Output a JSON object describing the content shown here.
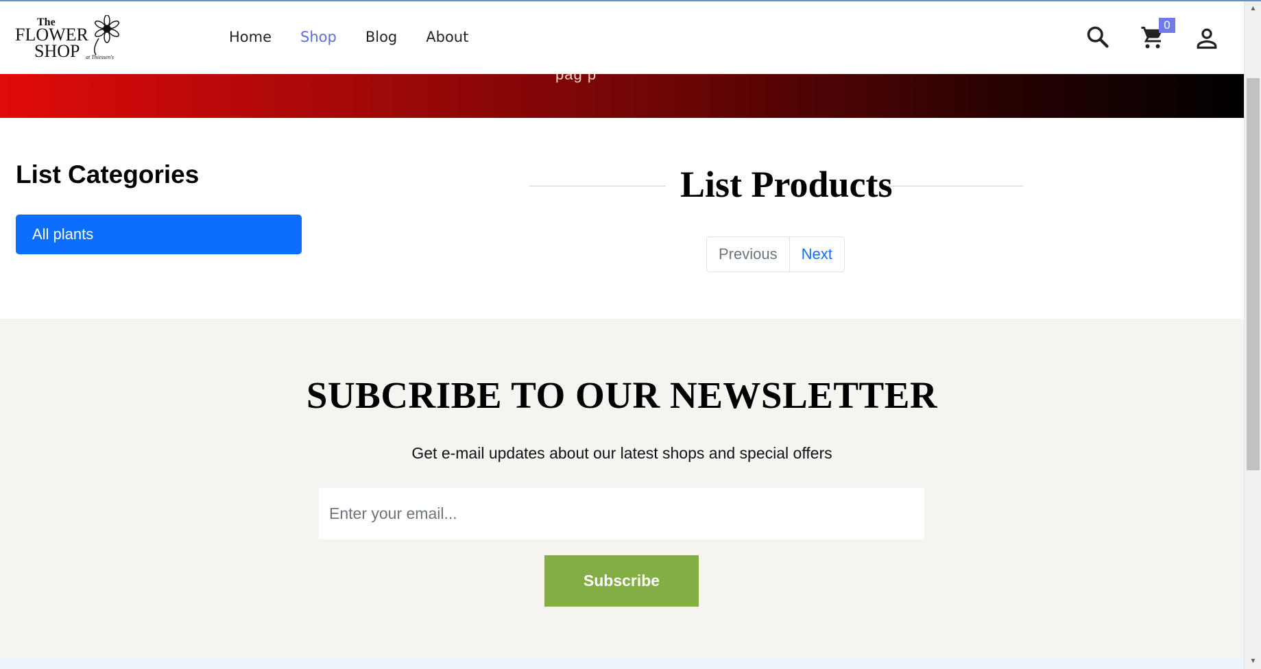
{
  "header": {
    "logo": {
      "line1": "The",
      "line2": "FLOWER",
      "line3": "SHOP",
      "tagline": "at Thiessen's"
    },
    "nav": [
      {
        "label": "Home",
        "active": false
      },
      {
        "label": "Shop",
        "active": true
      },
      {
        "label": "Blog",
        "active": false
      },
      {
        "label": "About",
        "active": false
      }
    ],
    "icons": {
      "search": "search-icon",
      "cart": "cart-icon",
      "account": "user-icon"
    },
    "cart_count": "0"
  },
  "banner": {
    "visible_text_fragment": "pag            p"
  },
  "categories": {
    "title": "List Categories",
    "items": [
      {
        "label": "All plants",
        "active": true
      }
    ]
  },
  "products": {
    "title": "List Products",
    "pagination": {
      "previous": "Previous",
      "next": "Next"
    }
  },
  "newsletter": {
    "title": "SUBCRIBE TO OUR NEWSLETTER",
    "subtitle": "Get e-mail updates about our latest shops and special offers",
    "email_placeholder": "Enter your email...",
    "button_label": "Subscribe"
  },
  "colors": {
    "accent": "#0d6efd",
    "nav_active": "#5b6fd6",
    "subscribe": "#83ad45",
    "newsletter_bg": "#f5f4f1",
    "banner_start": "#e00a0a",
    "banner_end": "#000000"
  }
}
